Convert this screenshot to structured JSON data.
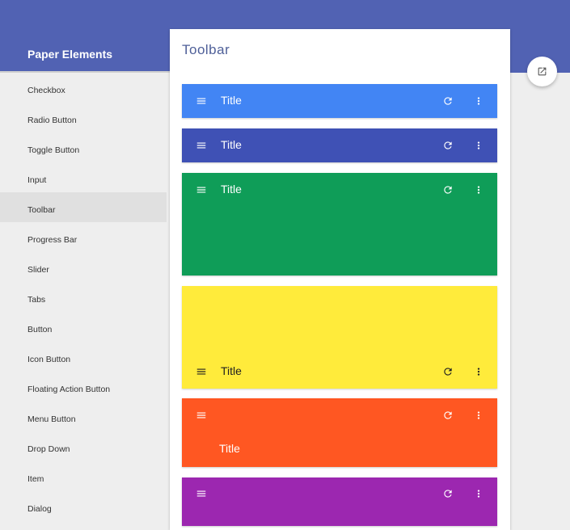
{
  "app": {
    "title": "Paper Elements"
  },
  "sidebar": {
    "items": [
      {
        "label": "Checkbox"
      },
      {
        "label": "Radio Button"
      },
      {
        "label": "Toggle Button"
      },
      {
        "label": "Input"
      },
      {
        "label": "Toolbar",
        "selected": true
      },
      {
        "label": "Progress Bar"
      },
      {
        "label": "Slider"
      },
      {
        "label": "Tabs"
      },
      {
        "label": "Button"
      },
      {
        "label": "Icon Button"
      },
      {
        "label": "Floating Action Button"
      },
      {
        "label": "Menu Button"
      },
      {
        "label": "Drop Down"
      },
      {
        "label": "Item"
      },
      {
        "label": "Dialog"
      }
    ]
  },
  "main": {
    "title": "Toolbar",
    "toolbars": [
      {
        "title": "Title",
        "color": "#4285f4",
        "text_color": "#ffffff",
        "variant": "default"
      },
      {
        "title": "Title",
        "color": "#3f51b5",
        "text_color": "#ffffff",
        "variant": "default"
      },
      {
        "title": "Title",
        "color": "#0f9d58",
        "text_color": "#ffffff",
        "variant": "tall-top"
      },
      {
        "title": "Title",
        "color": "#ffeb3b",
        "text_color": "#212121",
        "variant": "tall-bottom"
      },
      {
        "title": "Title",
        "color": "#ff5722",
        "text_color": "#ffffff",
        "variant": "title-second-row"
      },
      {
        "title": "",
        "color": "#9c27b0",
        "text_color": "#ffffff",
        "variant": "no-title"
      }
    ]
  },
  "fab": {
    "icon": "open-in-new-icon"
  },
  "icons": {
    "menu": "menu-icon",
    "refresh": "refresh-icon",
    "more": "more-vert-icon"
  }
}
